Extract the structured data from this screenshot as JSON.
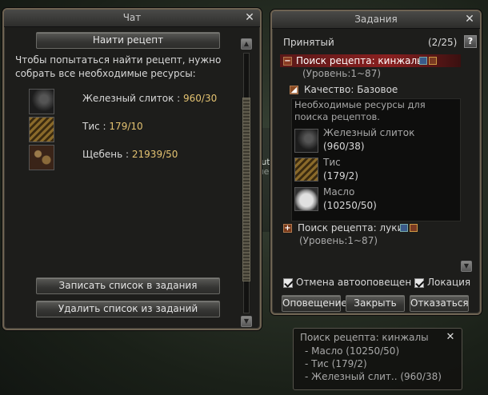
{
  "chat": {
    "title": "Чат",
    "find_recipe_label": "Наити рецепт",
    "instruction": "Чтобы попытаться найти рецепт, нужно собрать все необходимые ресурсы:",
    "resources": [
      {
        "icon": "iron-ingot-icon",
        "name": "Железный слиток :",
        "count": "960/30"
      },
      {
        "icon": "yew-icon",
        "name": "Тис :",
        "count": "179/10"
      },
      {
        "icon": "gravel-icon",
        "name": "Щебень :",
        "count": "21939/50"
      }
    ],
    "add_to_quests_label": "Записать список в задания",
    "remove_from_quests_label": "Удалить список из заданий"
  },
  "quests": {
    "title": "Задания",
    "accepted_label": "Принятый",
    "count": "(2/25)",
    "help": "?",
    "quest1": {
      "name": "Поиск рецепта: кинжалы",
      "level": "(Уровень:1~87)"
    },
    "quality_label": "Качество: Базовое",
    "req_text": "Необходимые ресурсы для поиска рецептов.",
    "items": [
      {
        "icon": "iron-ingot-icon",
        "name": "Железный слиток",
        "count": "(960/38)"
      },
      {
        "icon": "yew-icon",
        "name": "Тис",
        "count": "(179/2)"
      },
      {
        "icon": "oil-icon",
        "name": "Масло",
        "count": "(10250/50)"
      }
    ],
    "quest2": {
      "name": "Поиск рецепта: луки",
      "level": "(Уровень:1~87)"
    },
    "auto_notify_label": "Отмена автооповещен",
    "location_label": "Локация",
    "notify_btn": "Оповещение",
    "close_btn": "Закрыть",
    "reject_btn": "Отказаться"
  },
  "tracker": {
    "title": "Поиск рецепта: кинжалы",
    "lines": [
      "- Масло (10250/50)",
      "- Тис (179/2)",
      "- Железный слит..   (960/38)"
    ]
  },
  "background_text": [
    "tuto",
    "ковале"
  ]
}
